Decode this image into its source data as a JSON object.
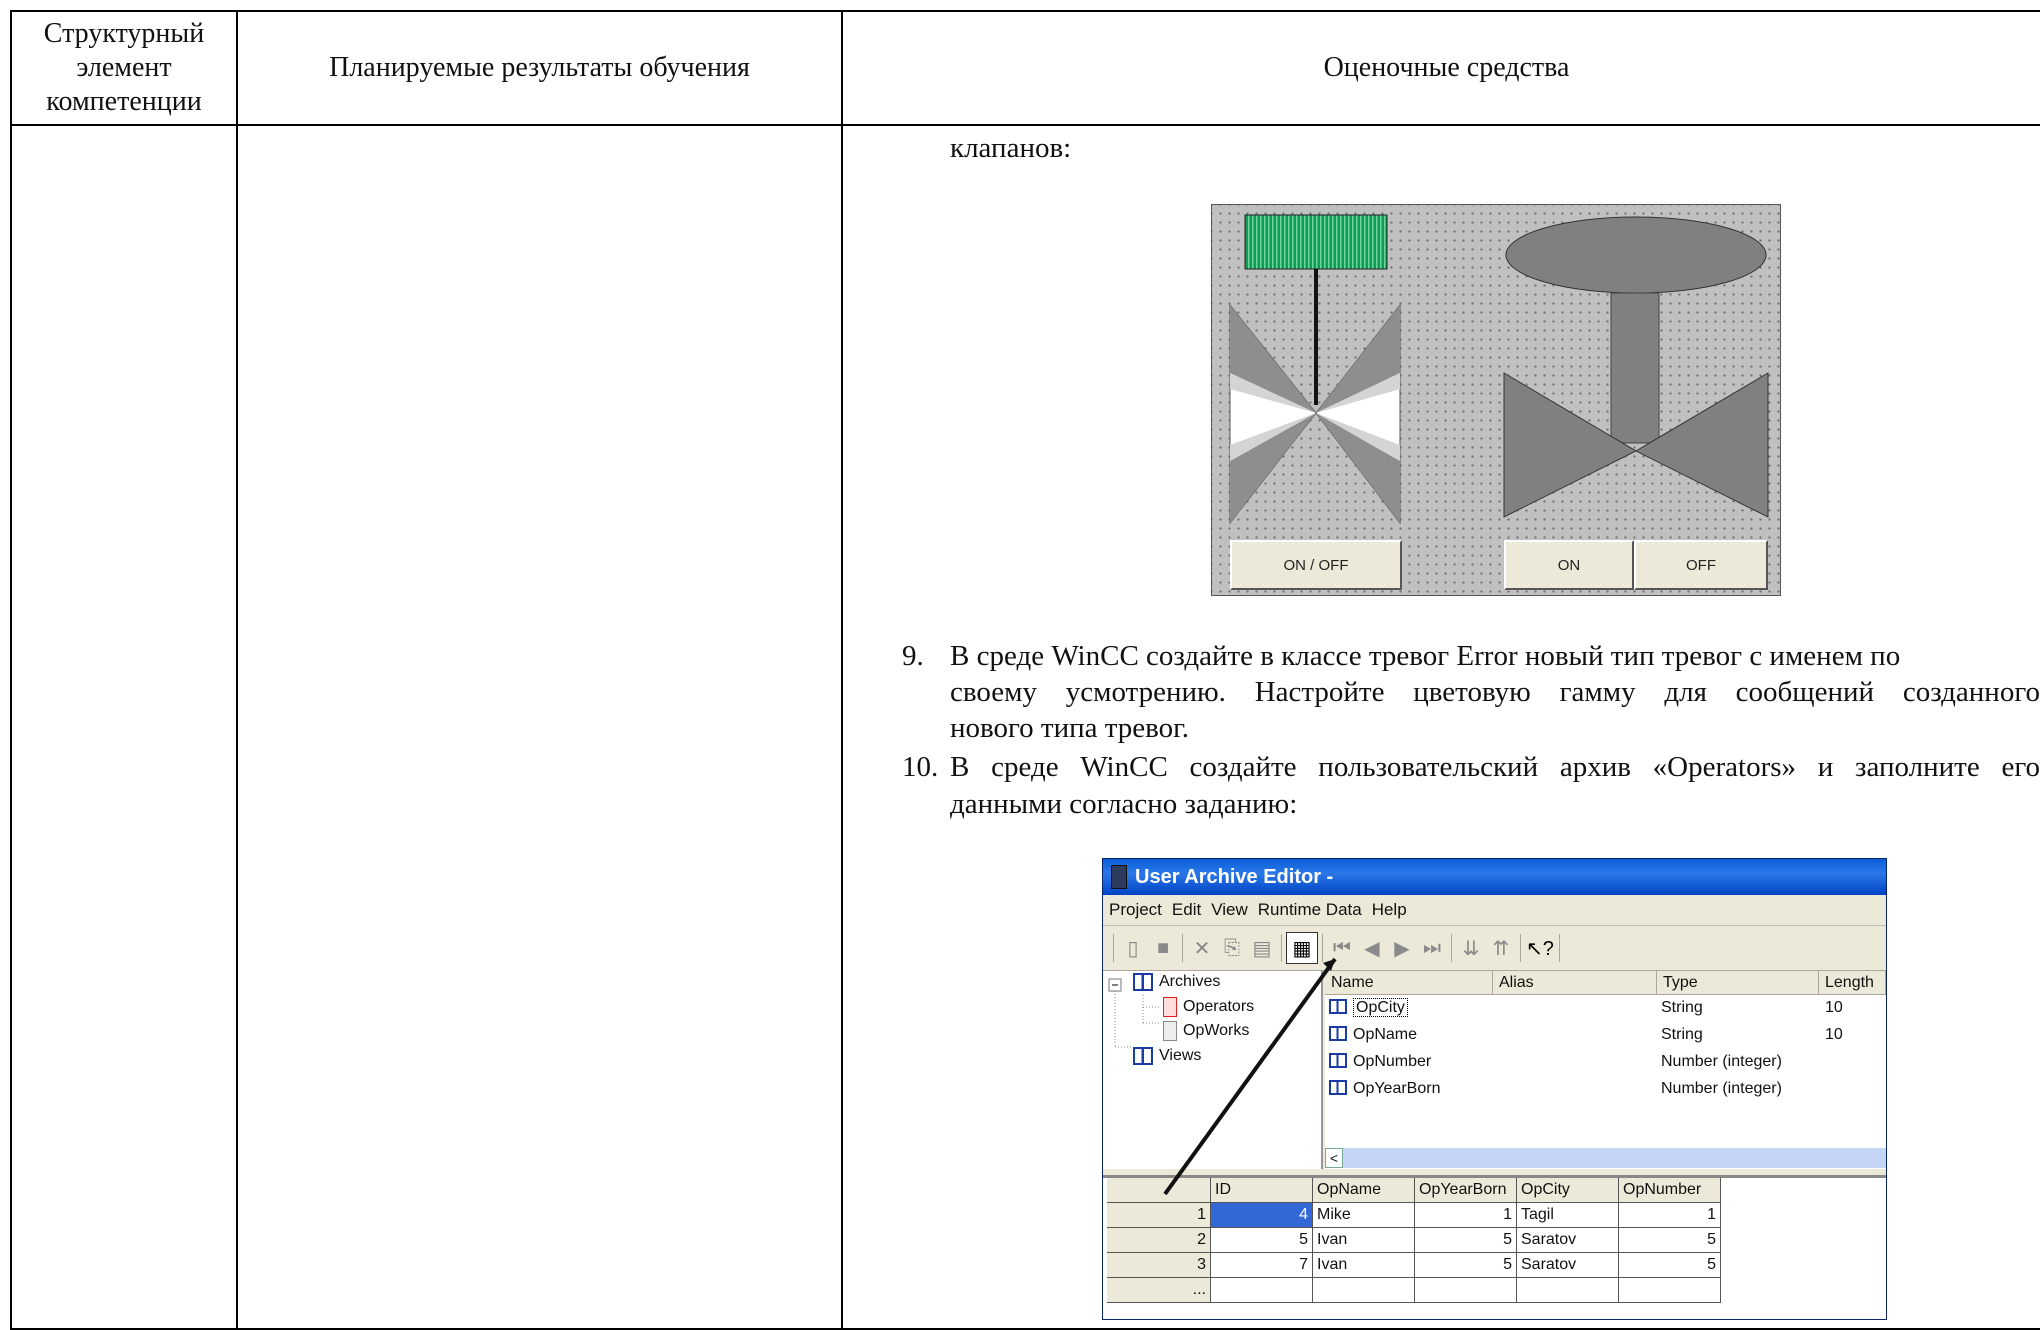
{
  "header": {
    "col1": "Структурный элемент компетенции",
    "col2": "Планируемые результаты обучения",
    "col3": "Оценочные средства"
  },
  "intro_text": "клапанов:",
  "valve_panel": {
    "buttons": [
      "ON / OFF",
      "ON",
      "OFF"
    ],
    "colors": {
      "background": "#c0c0c0",
      "indicator": "#0f9a55",
      "actuator": "#808080"
    }
  },
  "tasks": [
    {
      "number": "9.",
      "lines": [
        "В среде WinCC создайте в классе тревог Error новый тип тревог с именем по",
        "своему усмотрению. Настройте цветовую гамму для сообщений созданного",
        "нового типа тревог."
      ]
    },
    {
      "number": "10.",
      "lines": [
        "В среде WinCC создайте пользовательский архив «Operators» и заполните его",
        "данными согласно заданию:"
      ]
    }
  ],
  "user_archive_editor": {
    "title": "User Archive Editor -",
    "menu": [
      "Project",
      "Edit",
      "View",
      "Runtime Data",
      "Help"
    ],
    "tree": {
      "root": "Archives",
      "children": [
        "Operators",
        "OpWorks"
      ],
      "views": "Views"
    },
    "fields": {
      "columns": [
        "Name",
        "Alias",
        "Type",
        "Length"
      ],
      "rows": [
        {
          "name": "OpCity",
          "type": "String",
          "length": "10"
        },
        {
          "name": "OpName",
          "type": "String",
          "length": "10"
        },
        {
          "name": "OpNumber",
          "type": "Number (integer)",
          "length": ""
        },
        {
          "name": "OpYearBorn",
          "type": "Number (integer)",
          "length": ""
        }
      ]
    },
    "grid": {
      "columns": [
        "ID",
        "OpName",
        "OpYearBorn",
        "OpCity",
        "OpNumber"
      ],
      "rows": [
        {
          "row": "1",
          "id": "4",
          "name": "Mike",
          "year": "1",
          "city": "Tagil",
          "number": "1"
        },
        {
          "row": "2",
          "id": "5",
          "name": "Ivan",
          "year": "5",
          "city": "Saratov",
          "number": "5"
        },
        {
          "row": "3",
          "id": "7",
          "name": "Ivan",
          "year": "5",
          "city": "Saratov",
          "number": "5"
        }
      ],
      "new_row": "..."
    },
    "colors": {
      "titlebar": "#0a5fd8",
      "selection": "#3168d5",
      "chrome": "#ece9d8"
    }
  }
}
